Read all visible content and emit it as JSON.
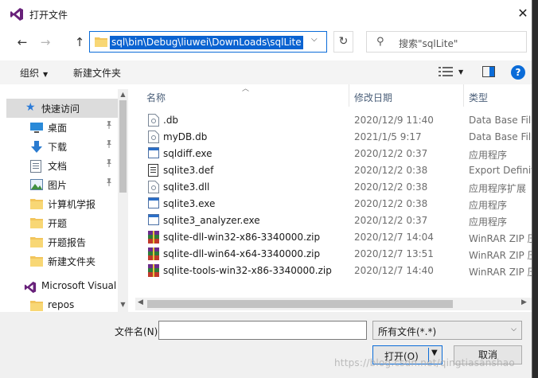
{
  "window": {
    "title": "打开文件",
    "close_symbol": "✕"
  },
  "nav": {
    "back": "←",
    "forward": "→",
    "up": "↑"
  },
  "address": {
    "path": "sql\\bin\\Debug\\liuwei\\DownLoads\\sqlLite",
    "dropdown": "⌵"
  },
  "refresh_symbol": "↻",
  "search": {
    "placeholder": "搜索\"sqlLite\"",
    "icon_symbol": "⚲"
  },
  "toolbar": {
    "organize": "组织",
    "new_folder": "新建文件夹",
    "caret": "▼",
    "view_caret": "▼",
    "help": "?"
  },
  "sidebar": {
    "items": [
      {
        "label": "快速访问",
        "icon": "star-icon"
      },
      {
        "label": "桌面",
        "icon": "desktop-icon",
        "pinned": true
      },
      {
        "label": "下载",
        "icon": "download-icon",
        "pinned": true
      },
      {
        "label": "文档",
        "icon": "document-icon",
        "pinned": true
      },
      {
        "label": "图片",
        "icon": "picture-icon",
        "pinned": true
      },
      {
        "label": "计算机学报",
        "icon": "folder-icon"
      },
      {
        "label": "开题",
        "icon": "folder-icon"
      },
      {
        "label": "开题报告",
        "icon": "folder-icon"
      },
      {
        "label": "新建文件夹",
        "icon": "folder-icon"
      },
      {
        "label": "Microsoft Visual",
        "icon": "visual-studio-icon"
      },
      {
        "label": "repos",
        "icon": "folder-icon"
      }
    ],
    "pin_symbol": "📌"
  },
  "columns": {
    "name": "名称",
    "date": "修改日期",
    "type": "类型"
  },
  "files": [
    {
      "name": ".db",
      "date": "2020/12/9 11:40",
      "type": "Data Base File",
      "icon": "generic-file-icon"
    },
    {
      "name": "myDB.db",
      "date": "2021/1/5 9:17",
      "type": "Data Base File",
      "icon": "generic-file-icon"
    },
    {
      "name": "sqldiff.exe",
      "date": "2020/12/2 0:37",
      "type": "应用程序",
      "icon": "exe-icon"
    },
    {
      "name": "sqlite3.def",
      "date": "2020/12/2 0:38",
      "type": "Export Definition",
      "icon": "def-file-icon"
    },
    {
      "name": "sqlite3.dll",
      "date": "2020/12/2 0:38",
      "type": "应用程序扩展",
      "icon": "dll-icon"
    },
    {
      "name": "sqlite3.exe",
      "date": "2020/12/2 0:38",
      "type": "应用程序",
      "icon": "exe-icon"
    },
    {
      "name": "sqlite3_analyzer.exe",
      "date": "2020/12/2 0:37",
      "type": "应用程序",
      "icon": "exe-icon"
    },
    {
      "name": "sqlite-dll-win32-x86-3340000.zip",
      "date": "2020/12/7 14:04",
      "type": "WinRAR ZIP 压缩",
      "icon": "winrar-icon"
    },
    {
      "name": "sqlite-dll-win64-x64-3340000.zip",
      "date": "2020/12/7 13:51",
      "type": "WinRAR ZIP 压缩",
      "icon": "winrar-icon"
    },
    {
      "name": "sqlite-tools-win32-x86-3340000.zip",
      "date": "2020/12/7 14:40",
      "type": "WinRAR ZIP 压缩",
      "icon": "winrar-icon"
    }
  ],
  "filename": {
    "label": "文件名(N):",
    "value": ""
  },
  "filter": {
    "selected": "所有文件(*.*)"
  },
  "buttons": {
    "open": "打开(O)",
    "cancel": "取消"
  },
  "watermark": "https://blog.csdn.net/qingtiasanshao",
  "colors": {
    "accent": "#0b6cd8",
    "selection": "#0b63d1",
    "vs_purple": "#68217a"
  }
}
